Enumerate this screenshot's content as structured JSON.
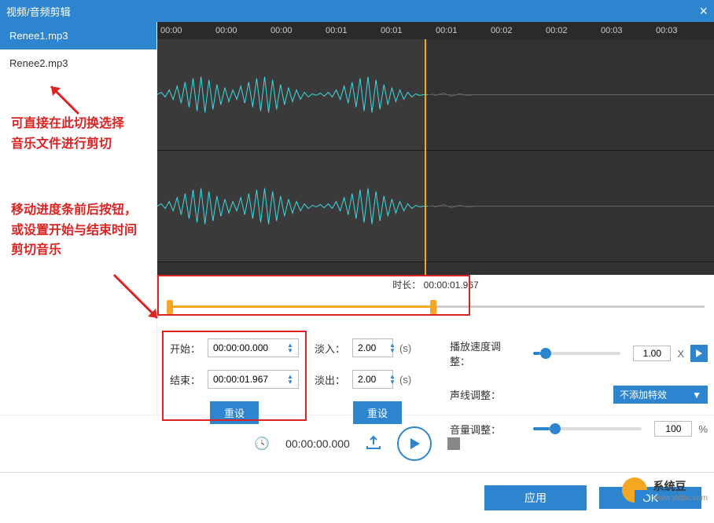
{
  "titlebar": {
    "title": "视频/音频剪辑"
  },
  "sidebar": {
    "files": [
      {
        "name": "Renee1.mp3",
        "active": true
      },
      {
        "name": "Renee2.mp3",
        "active": false
      }
    ]
  },
  "annotations": {
    "switch_hint": "可直接在此切换选择\n音乐文件进行剪切",
    "trim_hint": "移动进度条前后按钮，\n或设置开始与结束时间\n剪切音乐"
  },
  "timeline": {
    "ticks": [
      "00:00",
      "00:00",
      "00:00",
      "00:01",
      "00:01",
      "00:01",
      "00:02",
      "00:02",
      "00:03",
      "00:03"
    ]
  },
  "duration": {
    "label": "时长：",
    "value": "00:00:01.967"
  },
  "trim": {
    "start_label": "开始：",
    "start_value": "00:00:00.000",
    "end_label": "结束：",
    "end_value": "00:00:01.967",
    "reset": "重设"
  },
  "fade": {
    "in_label": "淡入：",
    "in_value": "2.00",
    "out_label": "淡出：",
    "out_value": "2.00",
    "unit": "(s)",
    "reset": "重设"
  },
  "speed": {
    "label": "播放速度调整：",
    "value": "1.00",
    "unit": "X",
    "slider_pct": 8
  },
  "voice": {
    "label": "声线调整：",
    "dropdown": "不添加特效"
  },
  "volume": {
    "label": "音量调整：",
    "value": "100",
    "unit": "%",
    "slider_pct": 15
  },
  "playback": {
    "time": "00:00:00.000"
  },
  "footer": {
    "apply": "应用",
    "ok": "OK"
  },
  "watermark": {
    "name": "系统豆",
    "url": "www.xtdpc.com"
  }
}
